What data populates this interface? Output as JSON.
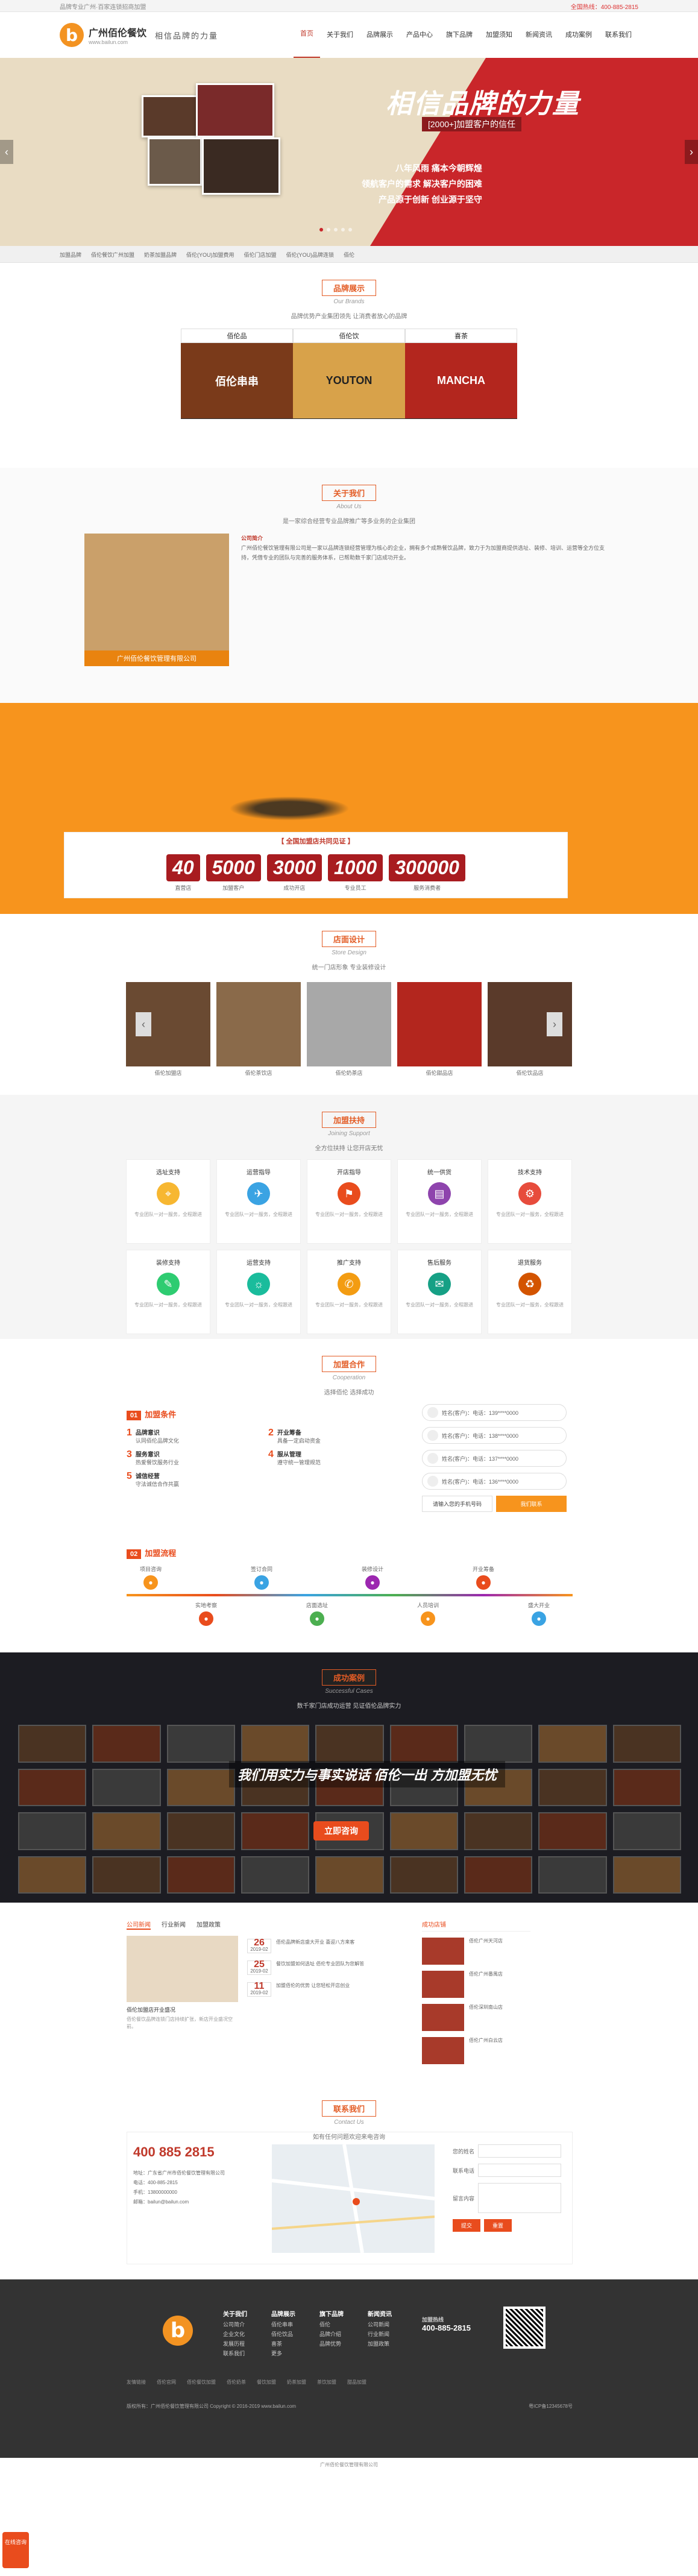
{
  "topbar": {
    "left": "品牌专业广州·百家连锁招商加盟",
    "hotline": "全国热线：400-885-2815"
  },
  "header": {
    "brand_cn": "广州佰伦餐饮",
    "brand_url": "www.bailun.com",
    "slogan": "相信品牌的力量",
    "nav": [
      "首页",
      "关于我们",
      "品牌展示",
      "产品中心",
      "旗下品牌",
      "加盟须知",
      "新闻资讯",
      "成功案例",
      "联系我们"
    ]
  },
  "banner": {
    "title": "相信品牌的力量",
    "sub": "[2000+]加盟客户的信任",
    "lines": [
      "八年风雨 痛本今朝辉煌",
      "领航客户的需求 解决客户的困难",
      "产品源于创新 创业源于坚守"
    ]
  },
  "crumbs": [
    "加盟品牌",
    "佰伦餐饮广州加盟",
    "奶茶加盟品牌",
    "佰伦(YOU)加盟费用",
    "佰伦门店加盟",
    "佰伦(YOU)品牌连锁",
    "佰伦"
  ],
  "brands_section": {
    "title": "品牌展示",
    "en": "Our Brands",
    "desc": "品牌优势产业集团领先 让消费者放心的品牌"
  },
  "brands": [
    {
      "name": "佰伦品",
      "img": "佰伦串串"
    },
    {
      "name": "佰伦饮",
      "img": "YOUTON"
    },
    {
      "name": "喜茶",
      "img": "MANCHA"
    }
  ],
  "about_section": {
    "title": "关于我们",
    "en": "About Us",
    "desc": "是一家综合经营专业品牌推广等多业务的企业集团"
  },
  "about": {
    "caption": "广州佰伦餐饮管理有限公司",
    "heading": "公司简介",
    "text": "广州佰伦餐饮管理有限公司是一家以品牌连锁经营管理为核心的企业，拥有多个成熟餐饮品牌，致力于为加盟商提供选址、装修、培训、运营等全方位支持，凭借专业的团队与完善的服务体系，已帮助数千家门店成功开业。"
  },
  "stats_section": {
    "head": "【 全国加盟店共同见证 】"
  },
  "stats": [
    {
      "num": "40",
      "lbl": "直营店"
    },
    {
      "num": "5000",
      "lbl": "加盟客户"
    },
    {
      "num": "3000",
      "lbl": "成功开店"
    },
    {
      "num": "1000",
      "lbl": "专业员工"
    },
    {
      "num": "300000",
      "lbl": "服务消费者"
    }
  ],
  "stores_section": {
    "title": "店面设计",
    "en": "Store Design",
    "desc": "统一门店形象 专业装修设计"
  },
  "stores": [
    "佰伦加盟店",
    "佰伦茶饮店",
    "佰伦奶茶店",
    "佰伦甜品店",
    "佰伦饮品店"
  ],
  "support_section": {
    "title": "加盟扶持",
    "en": "Joining Support",
    "desc": "全方位扶持 让您开店无忧"
  },
  "support": [
    {
      "h": "选址支持",
      "c": "#f7b731",
      "i": "⌖"
    },
    {
      "h": "运营指导",
      "c": "#3aa3e3",
      "i": "✈"
    },
    {
      "h": "开店指导",
      "c": "#e94c1d",
      "i": "⚑"
    },
    {
      "h": "统一供货",
      "c": "#8e44ad",
      "i": "▤"
    },
    {
      "h": "技术支持",
      "c": "#e74c3c",
      "i": "⚙"
    },
    {
      "h": "装修支持",
      "c": "#2ecc71",
      "i": "✎"
    },
    {
      "h": "运营支持",
      "c": "#1abc9c",
      "i": "☼"
    },
    {
      "h": "推广支持",
      "c": "#f39c12",
      "i": "✆"
    },
    {
      "h": "售后服务",
      "c": "#16a085",
      "i": "✉"
    },
    {
      "h": "退货服务",
      "c": "#d35400",
      "i": "♻"
    }
  ],
  "support_text": "专业团队一对一服务，全程跟进",
  "coop_section": {
    "title": "加盟合作",
    "en": "Cooperation",
    "desc": "选择佰伦 选择成功"
  },
  "coop": {
    "tag1": "01",
    "h1": "加盟条件",
    "tag2": "02",
    "h2": "加盟流程",
    "conds": [
      {
        "n": "1",
        "t": "品牌意识",
        "p": "认同佰伦品牌文化"
      },
      {
        "n": "2",
        "t": "开业筹备",
        "p": "具备一定启动资金"
      },
      {
        "n": "3",
        "t": "服务意识",
        "p": "热爱餐饮服务行业"
      },
      {
        "n": "4",
        "t": "服从管理",
        "p": "遵守统一管理规范"
      },
      {
        "n": "5",
        "t": "诚信经营",
        "p": "守法诚信合作共赢"
      }
    ]
  },
  "form": {
    "rows": [
      "姓名(客户)：电话：139****0000",
      "姓名(客户)：电话：138****0000",
      "姓名(客户)：电话：137****0000",
      "姓名(客户)：电话：136****0000"
    ],
    "btn1": "请输入您的手机号码",
    "btn2": "我们联系"
  },
  "flow": [
    {
      "t": "项目咨询",
      "c": "#f7941d"
    },
    {
      "t": "实地考察",
      "c": "#e94c1d"
    },
    {
      "t": "签订合同",
      "c": "#3aa3e3"
    },
    {
      "t": "店面选址",
      "c": "#4caf50"
    },
    {
      "t": "装修设计",
      "c": "#9c27b0"
    },
    {
      "t": "人员培训",
      "c": "#f7941d"
    },
    {
      "t": "开业筹备",
      "c": "#e94c1d"
    },
    {
      "t": "盛大开业",
      "c": "#3aa3e3"
    }
  ],
  "cases_section": {
    "title": "成功案例",
    "en": "Successful Cases",
    "desc": "数千家门店成功运营 见证佰伦品牌实力"
  },
  "cases": {
    "overlay": "我们用实力与事实说话 佰伦一出 方加盟无忧",
    "cta": "立即咨询"
  },
  "news": {
    "tabs": [
      "公司新闻",
      "行业新闻",
      "加盟政策"
    ],
    "right_head": "成功店铺",
    "left_title": "佰伦加盟店开业盛况",
    "left_text": "佰伦餐饮品牌连锁门店持续扩张，新店开业盛况空前。",
    "items": [
      {
        "d": "26",
        "m": "2019-02",
        "t": "佰伦品牌新店盛大开业 喜迎八方来客"
      },
      {
        "d": "25",
        "m": "2019-02",
        "t": "餐饮加盟如何选址 佰伦专业团队为您解答"
      },
      {
        "d": "11",
        "m": "2019-02",
        "t": "加盟佰伦的优势 让您轻松开店创业"
      }
    ],
    "right": [
      "佰伦广州天河店",
      "佰伦广州番禺店",
      "佰伦深圳南山店",
      "佰伦广州白云店"
    ]
  },
  "contact_section": {
    "title": "联系我们",
    "en": "Contact Us",
    "desc": "如有任何问题欢迎来电咨询"
  },
  "contact": {
    "tel": "400 885 2815",
    "info": [
      "地址：广东省广州市佰伦餐饮管理有限公司",
      "电话：400-885-2815",
      "手机：13800000000",
      "邮箱：bailun@bailun.com"
    ],
    "f1": "您的姓名",
    "f2": "联系电话",
    "f3": "留言内容",
    "b1": "提交",
    "b2": "重置"
  },
  "footer": {
    "cols": [
      {
        "h": "关于我们",
        "i": [
          "公司简介",
          "企业文化",
          "发展历程",
          "联系我们"
        ]
      },
      {
        "h": "品牌展示",
        "i": [
          "佰伦串串",
          "佰伦饮品",
          "喜茶",
          "更多"
        ]
      },
      {
        "h": "旗下品牌",
        "i": [
          "佰伦",
          "品牌介绍",
          "品牌优势"
        ]
      },
      {
        "h": "新闻资讯",
        "i": [
          "公司新闻",
          "行业新闻",
          "加盟政策"
        ]
      }
    ],
    "tel_label": "加盟热线",
    "tel": "400-885-2815",
    "links": [
      "友情链接",
      "佰伦官网",
      "佰伦餐饮加盟",
      "佰伦奶茶",
      "餐饮加盟",
      "奶茶加盟",
      "茶饮加盟",
      "甜品加盟"
    ],
    "copy": "版权所有：广州佰伦餐饮管理有限公司 Copyright © 2016-2019 www.bailun.com",
    "icp": "粤ICP备12345678号"
  },
  "bottom": "广州佰伦餐饮管理有限公司",
  "online": "在线咨询"
}
